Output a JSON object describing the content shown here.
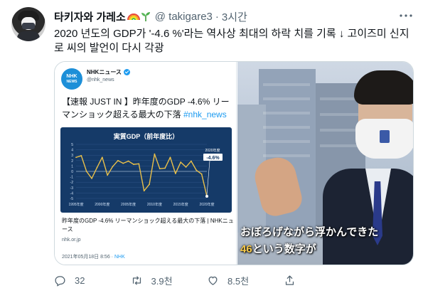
{
  "tweet": {
    "display_name": "타키자와 가레소",
    "handle": "@ takigare3",
    "separator": "·",
    "time": "3시간",
    "text": "2020 년도의 GDP가 '-4.6 %'라는 역사상 최대의 하락 치를 기록 ↓ 고이즈미 신지로 씨의 발언이 다시 각광",
    "more_icon": "more-icon"
  },
  "quoted": {
    "logo_line1": "NHK",
    "logo_line2": "NEWS",
    "name": "NHKニュース",
    "handle": "@nhk_news",
    "text_main": "【速報 JUST IN 】昨年度のGDP -4.6% リーマンショック超える最大の下落",
    "hashtag": "#nhk_news",
    "link_title": "昨年度のGDP -4.6% リーマンショック超える最大の下落 | NHKニュース",
    "link_domain": "nhk.or.jp",
    "date": "2021年05月18日 8:56",
    "date_sep": " · ",
    "source": "NHK"
  },
  "video": {
    "caption_line1": "おぼろげながら浮かんできた",
    "caption_accent": "46",
    "caption_line2_rest": "という数字が"
  },
  "actions": {
    "reply_count": "32",
    "retweet_count": "3.9천",
    "like_count": "8.5천"
  },
  "colors": {
    "accent": "#1d9bf0",
    "muted": "#536471",
    "chart_bg": "#153a68",
    "chart_line": "#e9c04a"
  },
  "chart_data": {
    "type": "line",
    "title": "実質GDP（前年度比）",
    "x": [
      1995,
      1996,
      1997,
      1998,
      1999,
      2000,
      2001,
      2002,
      2003,
      2004,
      2005,
      2006,
      2007,
      2008,
      2009,
      2010,
      2011,
      2012,
      2013,
      2014,
      2015,
      2016,
      2017,
      2018,
      2019,
      2020
    ],
    "series": [
      {
        "values": [
          2.6,
          2.9,
          0.0,
          -1.3,
          0.7,
          2.6,
          -0.7,
          0.9,
          2.0,
          1.5,
          1.9,
          1.3,
          1.4,
          -3.6,
          -2.4,
          3.2,
          0.5,
          0.6,
          2.6,
          -0.4,
          1.7,
          0.8,
          1.9,
          0.2,
          -0.5,
          -4.6
        ]
      }
    ],
    "xticks": [
      "1995年度",
      "2000年度",
      "2005年度",
      "2010年度",
      "2015年度",
      "2020年度"
    ],
    "yticks": [
      "5",
      "4",
      "3",
      "2",
      "1",
      "0",
      "-1",
      "-2",
      "-3",
      "-4",
      "-5"
    ],
    "ylim": [
      -5,
      5
    ],
    "annotation_label": "2020年度",
    "annotation_value": "-4.6%"
  }
}
